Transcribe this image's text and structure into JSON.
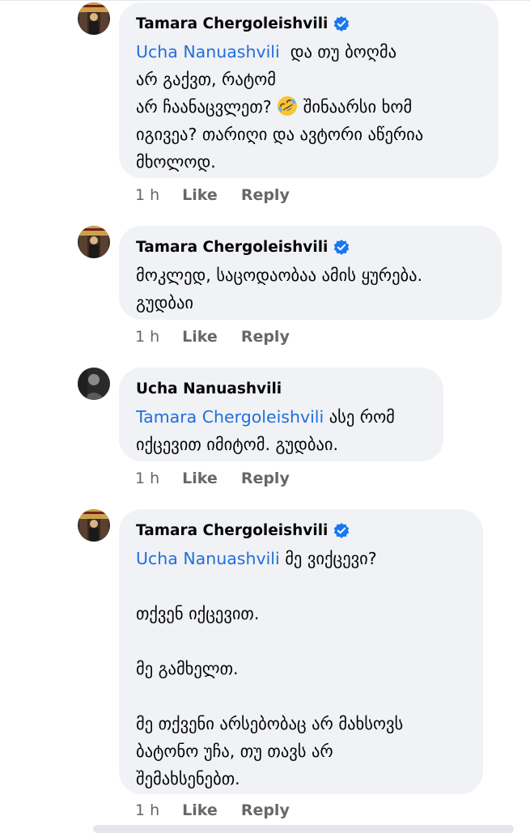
{
  "comments": [
    {
      "author": "Tamara Chergoleishvili",
      "verified": true,
      "avatar": "avatar-tamara",
      "mention": "Ucha Nanuashvili",
      "lines": [
        "და თუ ბოღმა",
        "არ გაქვთ, რატომ",
        "არ ჩაანაცვლეთ?",
        "შინაარსი ხომ",
        "იგივეა? თარიღი და ავტორი აწერია",
        "მხოლოდ."
      ],
      "emoji": "rolling-on-floor-laughing-emoji",
      "time": "1 h",
      "like": "Like",
      "reply": "Reply"
    },
    {
      "author": "Tamara Chergoleishvili",
      "verified": true,
      "avatar": "avatar-tamara",
      "lines": [
        "მოკლედ, საცოდაობაა ამის ყურება.",
        "გუდბაი"
      ],
      "time": "1 h",
      "like": "Like",
      "reply": "Reply"
    },
    {
      "author": "Ucha Nanuashvili",
      "verified": false,
      "avatar": "avatar-ucha",
      "mention": "Tamara Chergoleishvili",
      "lines": [
        "ასე რომ",
        "იქცევით იმიტომ. გუდბაი."
      ],
      "time": "1 h",
      "like": "Like",
      "reply": "Reply"
    },
    {
      "author": "Tamara Chergoleishvili",
      "verified": true,
      "avatar": "avatar-tamara",
      "mention": "Ucha Nanuashvili",
      "lines": [
        "მე ვიქცევი?",
        "თქვენ იქცევით.",
        "მე გამხელთ.",
        "მე თქვენი არსებობაც არ მახსოვს",
        "ბატონო უჩა, თუ თავს არ",
        "შემახსენებთ."
      ],
      "time": "1 h",
      "like": "Like",
      "reply": "Reply"
    }
  ],
  "colors": {
    "bubble": "#f0f2f5",
    "mention": "#216fdb",
    "verified": "#1877f2",
    "meta": "#65676b"
  }
}
